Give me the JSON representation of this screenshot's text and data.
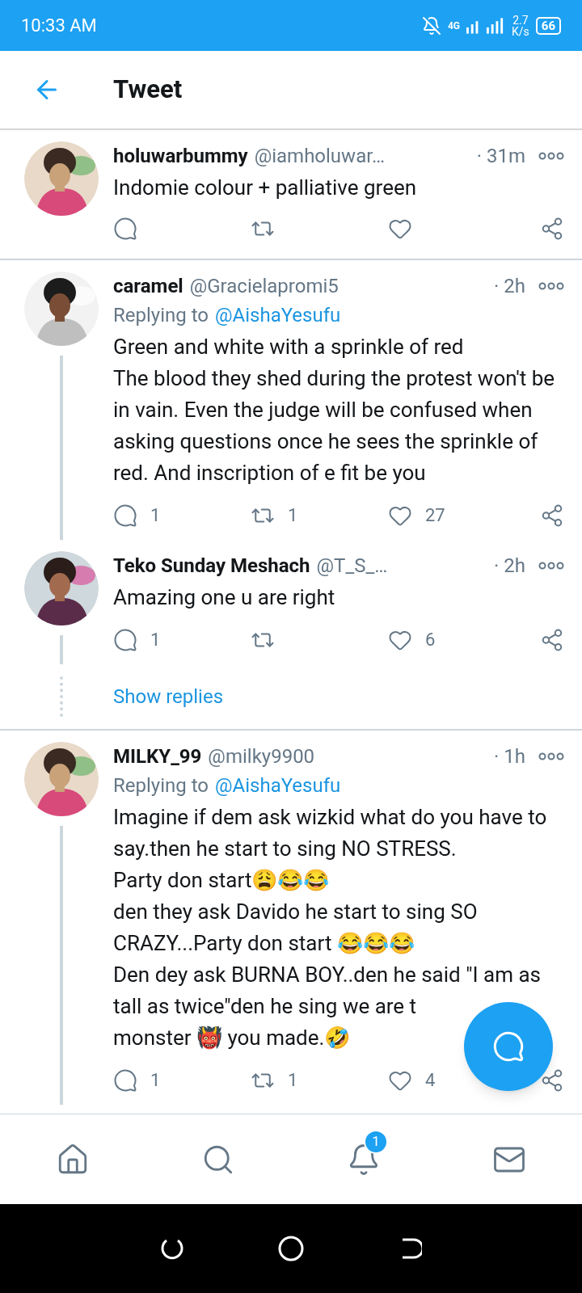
{
  "status_bar": {
    "time": "10:33 AM",
    "network": "4G",
    "speed": "2.7",
    "speed_unit": "K/s",
    "battery": "66"
  },
  "header": {
    "title": "Tweet"
  },
  "items": [
    {
      "kind": "tweet",
      "name": "holuwarbummy",
      "handle": "@iamholuwar…",
      "time": "· 31m",
      "connected": false,
      "body": [
        "Indomie colour + palliative green"
      ]
    },
    {
      "kind": "tweet",
      "name": "caramel",
      "handle": "@Gracielapromi5",
      "time": "· 2h",
      "replying_label": "Replying to",
      "replying_to": "@AishaYesufu",
      "connected": true,
      "body": [
        "Green and white with a sprinkle of red",
        "The blood they shed during the protest won't be in vain. Even the judge will be confused when asking questions once he sees the sprinkle of red. And inscription of e fit be you"
      ],
      "counts": {
        "reply": "1",
        "retweet": "1",
        "like": "27"
      }
    },
    {
      "kind": "tweet",
      "name": "Teko Sunday Meshach",
      "handle": "@T_S_…",
      "time": "· 2h",
      "connected": true,
      "body": [
        "Amazing one u are right"
      ],
      "counts": {
        "reply": "1",
        "like": "6"
      }
    },
    {
      "kind": "more",
      "label": "Show replies"
    },
    {
      "kind": "tweet",
      "name": "MILKY_99",
      "handle": "@milky9900",
      "time": "· 1h",
      "replying_label": "Replying to",
      "replying_to": "@AishaYesufu",
      "connected": true,
      "body": [
        "Imagine if dem ask wizkid what do you have to say.then he start to sing NO STRESS.",
        "Party don start😩😂😂",
        "den they ask Davido he start to sing SO CRAZY...Party don start 😂😂😂",
        "Den dey ask BURNA BOY..den he said \"I am as tall as twice\"den he sing we are t",
        "monster 👹 you made.🤣"
      ],
      "counts": {
        "reply": "1",
        "retweet": "1",
        "like": "4"
      }
    }
  ],
  "bottom_nav": [
    {
      "selected": false
    },
    {
      "selected": false
    },
    {
      "selected": false,
      "badge": "1"
    },
    {
      "selected": false
    }
  ]
}
